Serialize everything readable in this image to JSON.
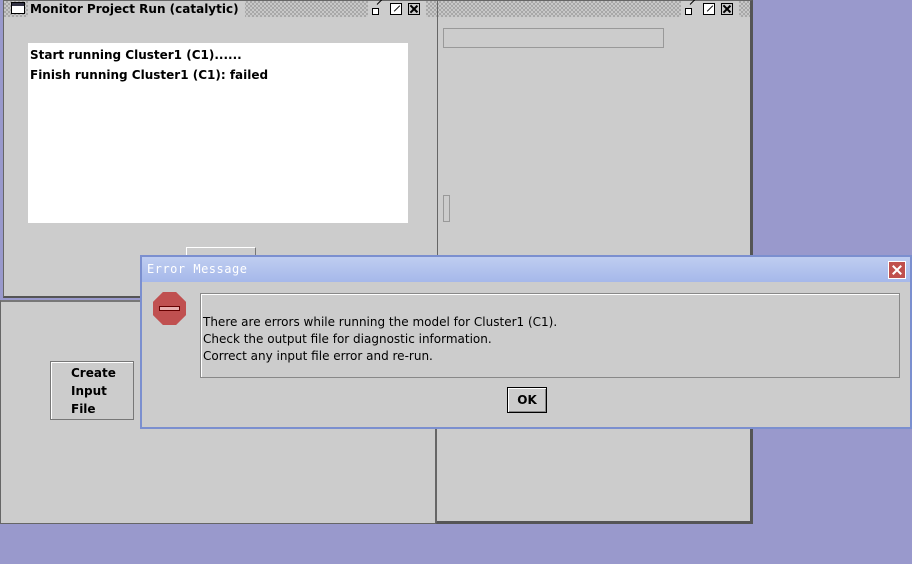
{
  "monitor_window": {
    "title": "Monitor Project Run  (catalytic)",
    "log_lines": [
      "Start running Cluster1 (C1)......",
      "Finish running Cluster1 (C1): failed"
    ]
  },
  "create_button": {
    "line1": "Create",
    "line2": "Input",
    "line3": "File"
  },
  "error_dialog": {
    "title": "Error Message",
    "messages": [
      "There are errors while running the model for Cluster1 (C1).",
      "Check the output file for diagnostic information.",
      "Correct any input file error and re-run."
    ],
    "ok_label": "OK"
  },
  "icons": {
    "window": "window-icon",
    "iconify": "iconify-icon",
    "maximize": "maximize-icon",
    "close": "close-icon",
    "error": "stop-sign-icon"
  },
  "colors": {
    "desktop": "#9999cc",
    "dialog_title": "#a6b8ea",
    "error_icon": "#c05050"
  }
}
